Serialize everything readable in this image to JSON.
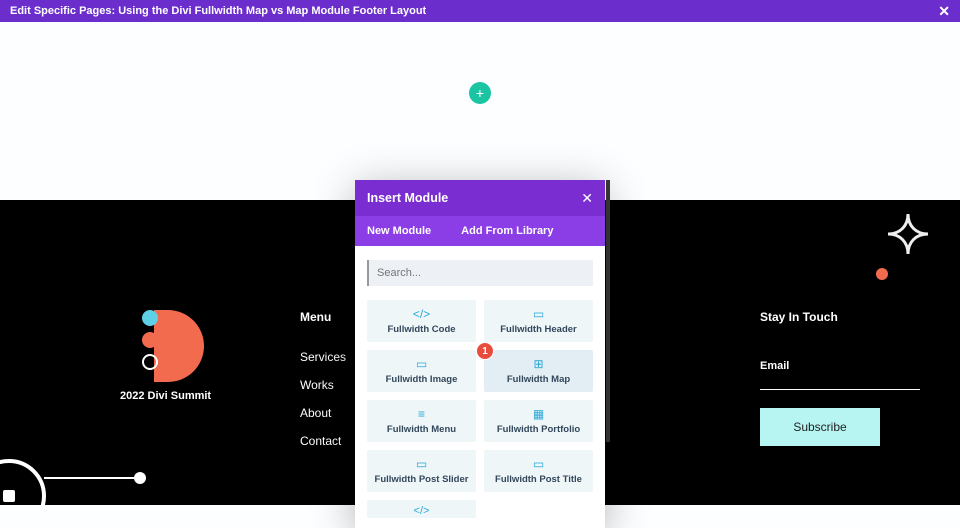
{
  "topbar": {
    "title": "Edit Specific Pages: Using the Divi Fullwidth Map vs Map Module Footer Layout",
    "close": "✕"
  },
  "canvas": {
    "plus": "+",
    "sectionAdd": "+"
  },
  "footer": {
    "logoCaption": "2022 Divi Summit",
    "menuHeading": "Menu",
    "links": [
      "Services",
      "Works",
      "About",
      "Contact"
    ],
    "touchHeading": "Stay In Touch",
    "emailLabel": "Email",
    "subscribe": "Subscribe"
  },
  "modal": {
    "title": "Insert Module",
    "close": "✕",
    "tabs": {
      "new": "New Module",
      "lib": "Add From Library"
    },
    "searchPlaceholder": "Search...",
    "badge": "1",
    "items": [
      {
        "icon": "</>",
        "label": "Fullwidth Code"
      },
      {
        "icon": "▭",
        "label": "Fullwidth Header"
      },
      {
        "icon": "▭",
        "label": "Fullwidth Image"
      },
      {
        "icon": "⊞",
        "label": "Fullwidth Map"
      },
      {
        "icon": "≡",
        "label": "Fullwidth Menu"
      },
      {
        "icon": "▦",
        "label": "Fullwidth Portfolio"
      },
      {
        "icon": "▭",
        "label": "Fullwidth Post Slider"
      },
      {
        "icon": "▭",
        "label": "Fullwidth Post Title"
      }
    ],
    "peekIcon": "</>"
  }
}
